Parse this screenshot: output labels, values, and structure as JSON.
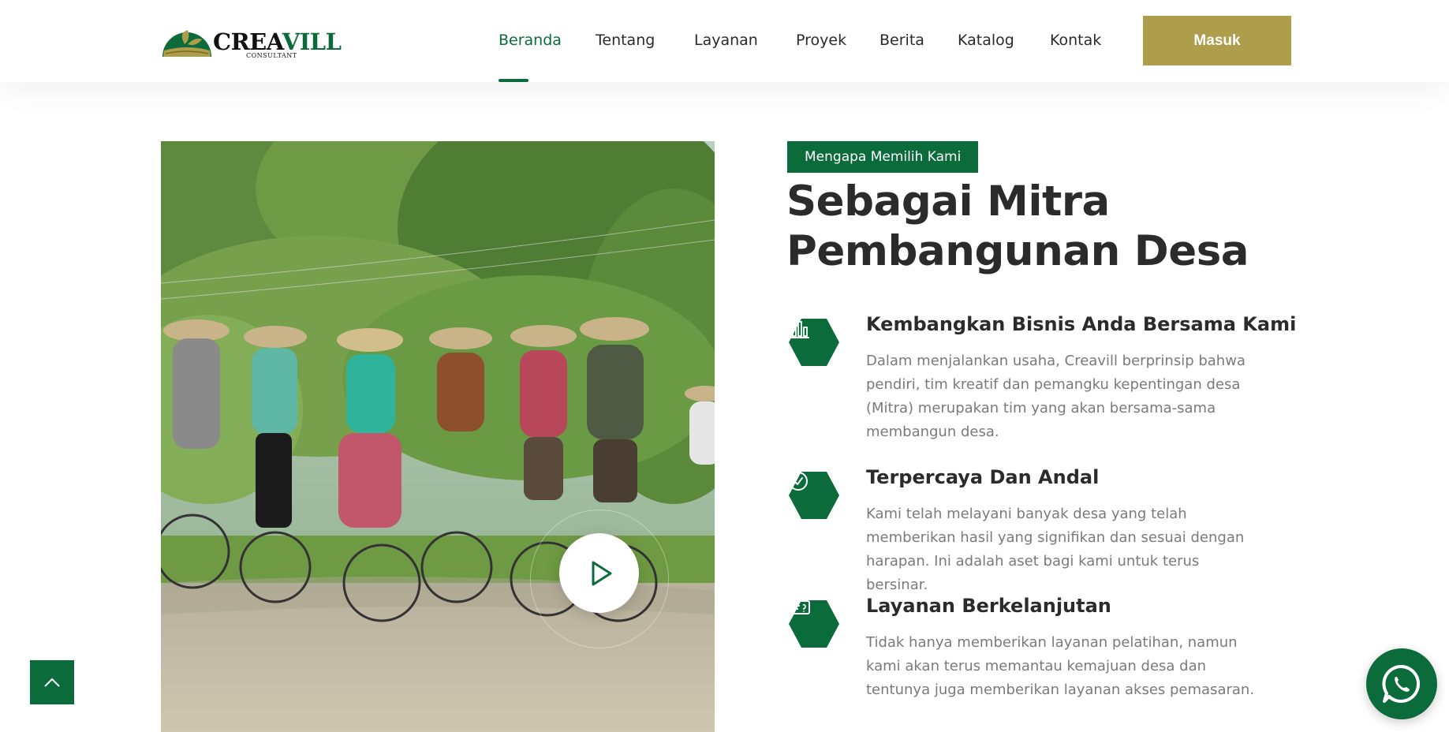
{
  "brand": {
    "name_part1": "CREA",
    "name_part2": "VILL",
    "subtitle": "CONSULTANT",
    "accent_color": "#0b6b3a",
    "gold_color": "#ae9e4c"
  },
  "nav": {
    "items": [
      {
        "label": "Beranda",
        "active": true
      },
      {
        "label": "Tentang"
      },
      {
        "label": "Layanan"
      },
      {
        "label": "Proyek"
      },
      {
        "label": "Berita"
      },
      {
        "label": "Katalog"
      },
      {
        "label": "Kontak"
      }
    ],
    "login_label": "Masuk"
  },
  "media": {
    "icon": "play-icon"
  },
  "section": {
    "tag": "Mengapa Memilih Kami",
    "heading_line1": "Sebagai Mitra",
    "heading_line2": "Pembangunan Desa",
    "features": [
      {
        "icon": "bar-chart-icon",
        "title": "Kembangkan Bisnis Anda Bersama Kami",
        "lines": [
          "Dalam menjalankan usaha, Creavill berprinsip bahwa",
          "pendiri, tim kreatif dan pemangku kepentingan desa",
          "(Mitra) merupakan tim yang akan bersama-sama",
          "membangun desa."
        ]
      },
      {
        "icon": "check-circle-icon",
        "title": "Terpercaya Dan Andal",
        "lines": [
          "Kami telah melayani banyak desa yang telah",
          "memberikan hasil yang signifikan dan sesuai dengan",
          "harapan. Ini adalah aset bagi kami untuk terus bersinar."
        ]
      },
      {
        "icon": "ticket-icon",
        "title": "Layanan Berkelanjutan",
        "lines": [
          "Tidak hanya memberikan layanan pelatihan, namun",
          "kami akan terus memantau kemajuan desa dan",
          "tentunya juga memberikan layanan akses pemasaran."
        ]
      }
    ]
  },
  "floating": {
    "scroll_top_icon": "chevron-up-icon",
    "whatsapp_icon": "whatsapp-icon"
  }
}
